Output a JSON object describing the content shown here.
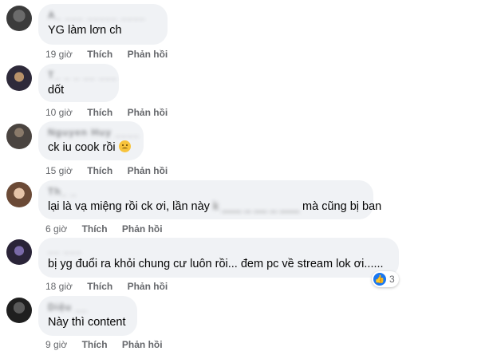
{
  "colors": {
    "bubble_bg": "#f0f2f5",
    "meta_text": "#65676b",
    "like_blue": "#1877f2"
  },
  "comments": [
    {
      "author": "A_ ___ _____ ____",
      "text": "YG làm lơn ch",
      "time": "19 giờ",
      "like_label": "Thích",
      "reply_label": "Phản hồi"
    },
    {
      "author": "T_ _ _ __ ___",
      "text": "dốt",
      "time": "10 giờ",
      "like_label": "Thích",
      "reply_label": "Phản hồi"
    },
    {
      "author": "Nguyen Huy ____",
      "text": "ck iu cook rồi",
      "emoji": "sad-face-icon",
      "time": "15 giờ",
      "like_label": "Thích",
      "reply_label": "Phản hồi"
    },
    {
      "author": "Th_ _",
      "text_before": "lại là vạ miệng rồi ck ơi, lần này",
      "text_hidden": "k ___ _ __ _ ___",
      "text_after": "mà cũng bị ban",
      "time": "6 giờ",
      "like_label": "Thích",
      "reply_label": "Phản hồi"
    },
    {
      "author": "__ ___",
      "text": "bị yg đuổi ra khỏi chung cư luôn rồi... đem pc về stream lok ơi......",
      "time": "18 giờ",
      "like_label": "Thích",
      "reply_label": "Phản hồi",
      "reaction_count": "3",
      "reaction_icon": "like-icon"
    },
    {
      "author": "Diệu __",
      "text": "Này thì content",
      "time": "9 giờ",
      "like_label": "Thích",
      "reply_label": "Phản hồi"
    }
  ]
}
